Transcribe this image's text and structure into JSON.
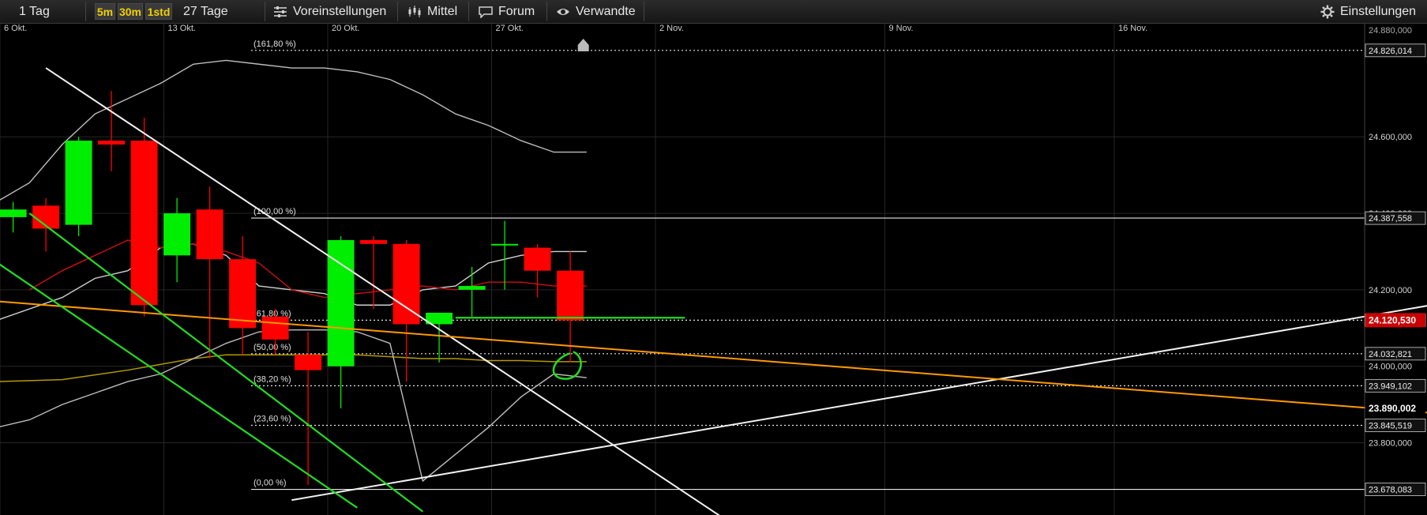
{
  "toolbar": {
    "period": "1 Tag",
    "timeframes": [
      "5m",
      "30m",
      "1std"
    ],
    "range": "27 Tage",
    "presets": "Voreinstellungen",
    "indicator": "Mittel",
    "forum": "Forum",
    "related": "Verwandte",
    "settings": "Einstellungen"
  },
  "colors": {
    "up": "#00ee00",
    "down": "#ff0000",
    "accent_label": "#cc0000",
    "trend_orange": "#ff9900"
  },
  "chart_data": {
    "type": "candlestick",
    "x_ticks": [
      "6 Okt.",
      "13 Okt.",
      "20 Okt.",
      "27 Okt.",
      "2 Nov.",
      "9 Nov.",
      "16 Nov."
    ],
    "x_tick_index": [
      0,
      5,
      10,
      15,
      20,
      27,
      34
    ],
    "y_ticks": [
      "24.600,000",
      "24.400,000",
      "24.200,000",
      "24.000,000",
      "23.800,000"
    ],
    "y_tick_values": [
      24600,
      24400,
      24200,
      24000,
      23800
    ],
    "ylim": [
      23640,
      24900
    ],
    "axis_top_label": "24.880,000",
    "candles": [
      {
        "i": 0,
        "o": 24390,
        "h": 24430,
        "l": 24350,
        "c": 24410
      },
      {
        "i": 1,
        "o": 24420,
        "h": 24440,
        "l": 24300,
        "c": 24360
      },
      {
        "i": 2,
        "o": 24370,
        "h": 24600,
        "l": 24340,
        "c": 24590
      },
      {
        "i": 3,
        "o": 24590,
        "h": 24720,
        "l": 24510,
        "c": 24580
      },
      {
        "i": 4,
        "o": 24590,
        "h": 24650,
        "l": 24130,
        "c": 24160
      },
      {
        "i": 5,
        "o": 24290,
        "h": 24440,
        "l": 24220,
        "c": 24400
      },
      {
        "i": 6,
        "o": 24410,
        "h": 24470,
        "l": 24020,
        "c": 24280
      },
      {
        "i": 7,
        "o": 24280,
        "h": 24340,
        "l": 24030,
        "c": 24100
      },
      {
        "i": 8,
        "o": 24130,
        "h": 24150,
        "l": 24030,
        "c": 24070
      },
      {
        "i": 9,
        "o": 24030,
        "h": 24090,
        "l": 23690,
        "c": 23990
      },
      {
        "i": 10,
        "o": 24000,
        "h": 24340,
        "l": 23890,
        "c": 24330
      },
      {
        "i": 11,
        "o": 24330,
        "h": 24340,
        "l": 24150,
        "c": 24320
      },
      {
        "i": 12,
        "o": 24320,
        "h": 24330,
        "l": 23960,
        "c": 24110
      },
      {
        "i": 13,
        "o": 24110,
        "h": 24140,
        "l": 24010,
        "c": 24140
      },
      {
        "i": 14,
        "o": 24200,
        "h": 24260,
        "l": 24130,
        "c": 24210
      },
      {
        "i": 15,
        "o": 24320,
        "h": 24380,
        "l": 24200,
        "c": 24320
      },
      {
        "i": 16,
        "o": 24310,
        "h": 24320,
        "l": 24180,
        "c": 24250
      },
      {
        "i": 17,
        "o": 24250,
        "h": 24300,
        "l": 24010,
        "c": 24120
      }
    ],
    "fib_levels": [
      {
        "label": "(161,80 %)",
        "value": 24826.014,
        "value_label": "24.826,014",
        "style": "dotted"
      },
      {
        "label": "(100,00 %)",
        "value": 24387.558,
        "value_label": "24.387,558",
        "style": "solid"
      },
      {
        "label": "(61,80 %)",
        "value": 24120.53,
        "value_label": "24.120,530",
        "style": "dotted"
      },
      {
        "label": "(50,00 %)",
        "value": 24032.821,
        "value_label": "24.032,821",
        "style": "dotted"
      },
      {
        "label": "(38,20 %)",
        "value": 23949.102,
        "value_label": "23.949,102",
        "style": "dotted"
      },
      {
        "label": "(23,60 %)",
        "value": 23845.519,
        "value_label": "23.845,519",
        "style": "dotted"
      },
      {
        "label": "(0,00 %)",
        "value": 23678.083,
        "value_label": "23.678,083",
        "style": "solid"
      }
    ],
    "current_price": {
      "value": 24120.53,
      "label": "24.120,530"
    },
    "extra_axis_label": {
      "value": 23890.002,
      "label": "23.890,002"
    },
    "bollinger_upper": [
      [
        -0.5,
        24430
      ],
      [
        0.5,
        24480
      ],
      [
        1.5,
        24580
      ],
      [
        2.5,
        24660
      ],
      [
        3.5,
        24700
      ],
      [
        4.5,
        24740
      ],
      [
        5.5,
        24790
      ],
      [
        6.5,
        24800
      ],
      [
        7.5,
        24790
      ],
      [
        8.5,
        24780
      ],
      [
        9.5,
        24780
      ],
      [
        10.5,
        24770
      ],
      [
        11.5,
        24750
      ],
      [
        12.5,
        24710
      ],
      [
        13.5,
        24660
      ],
      [
        14.5,
        24630
      ],
      [
        15.5,
        24590
      ],
      [
        16.5,
        24560
      ],
      [
        17.5,
        24560
      ]
    ],
    "bollinger_middle": [
      [
        -0.5,
        24120
      ],
      [
        1.5,
        24180
      ],
      [
        2.5,
        24230
      ],
      [
        3.5,
        24250
      ],
      [
        4.5,
        24310
      ],
      [
        5.5,
        24320
      ],
      [
        6.5,
        24290
      ],
      [
        7.5,
        24210
      ],
      [
        8.5,
        24200
      ],
      [
        9.5,
        24190
      ],
      [
        10.5,
        24160
      ],
      [
        11.5,
        24160
      ],
      [
        12.5,
        24200
      ],
      [
        13.5,
        24210
      ],
      [
        14.5,
        24270
      ],
      [
        15.5,
        24290
      ],
      [
        16.5,
        24300
      ],
      [
        17.5,
        24300
      ]
    ],
    "bollinger_lower": [
      [
        -0.5,
        23880
      ],
      [
        0.5,
        23900
      ],
      [
        1.5,
        23940
      ],
      [
        2.5,
        23970
      ],
      [
        3.5,
        24000
      ],
      [
        4.5,
        24020
      ],
      [
        5.5,
        24030
      ],
      [
        6.5,
        24060
      ],
      [
        7.5,
        24090
      ],
      [
        8.5,
        24120
      ],
      [
        9.5,
        24140
      ],
      [
        10.5,
        24160
      ],
      [
        11.5,
        24170
      ],
      [
        12.5,
        24200
      ],
      [
        13.5,
        24220
      ],
      [
        14.5,
        24250
      ],
      [
        15.5,
        24280
      ],
      [
        16.5,
        24290
      ],
      [
        17.5,
        24290
      ]
    ],
    "moving_avg_red": [
      [
        0.5,
        24200
      ],
      [
        1.5,
        24250
      ],
      [
        2.5,
        24290
      ],
      [
        3.5,
        24330
      ],
      [
        4.5,
        24310
      ],
      [
        5.5,
        24320
      ],
      [
        6.5,
        24300
      ],
      [
        7.5,
        24270
      ],
      [
        8.5,
        24200
      ],
      [
        9.5,
        24180
      ],
      [
        10.5,
        24190
      ],
      [
        11.5,
        24200
      ],
      [
        12.5,
        24210
      ],
      [
        13.5,
        24200
      ],
      [
        14.5,
        24220
      ],
      [
        15.5,
        24220
      ],
      [
        16.5,
        24210
      ],
      [
        17.5,
        24210
      ]
    ],
    "moving_avg_yellow": [
      [
        -0.5,
        23960
      ],
      [
        1.5,
        23965
      ],
      [
        3.5,
        23990
      ],
      [
        5.5,
        24020
      ],
      [
        6.5,
        24030
      ],
      [
        7.5,
        24030
      ],
      [
        8.5,
        24030
      ],
      [
        9.5,
        24030
      ],
      [
        10.5,
        24030
      ],
      [
        11.5,
        24025
      ],
      [
        12.5,
        24020
      ],
      [
        13.5,
        24020
      ],
      [
        14.5,
        24015
      ],
      [
        15.5,
        24015
      ],
      [
        16.5,
        24012
      ],
      [
        17.5,
        24012
      ]
    ],
    "bollinger_gray_low": [
      [
        -0.5,
        23840
      ],
      [
        0.5,
        23860
      ],
      [
        1.5,
        23900
      ],
      [
        2.5,
        23930
      ],
      [
        3.5,
        23960
      ],
      [
        4.5,
        23980
      ],
      [
        5.5,
        24020
      ],
      [
        6.5,
        24060
      ],
      [
        7.5,
        24090
      ],
      [
        8.5,
        24095
      ],
      [
        9.5,
        24095
      ],
      [
        10.5,
        24090
      ],
      [
        11.5,
        24060
      ],
      [
        12.5,
        23700
      ],
      [
        13.5,
        23770
      ],
      [
        14.5,
        23840
      ],
      [
        15.5,
        23920
      ],
      [
        16.5,
        23980
      ],
      [
        17.5,
        23970
      ]
    ],
    "trend_lines": [
      {
        "color": "white",
        "from": [
          1,
          24780
        ],
        "to": [
          22.6,
          23550
        ]
      },
      {
        "color": "white",
        "from": [
          8.5,
          23650
        ],
        "to": [
          46,
          24200
        ]
      },
      {
        "color": "orange",
        "from": [
          -0.5,
          24170
        ],
        "to": [
          46,
          23860
        ]
      },
      {
        "color": "green",
        "from": [
          0.5,
          24400
        ],
        "to": [
          12.5,
          23620
        ]
      },
      {
        "color": "green",
        "from": [
          -1.5,
          24330
        ],
        "to": [
          10.5,
          23630
        ]
      },
      {
        "color": "green",
        "from": [
          13.5,
          24127
        ],
        "to": [
          20.5,
          24127
        ]
      }
    ]
  }
}
